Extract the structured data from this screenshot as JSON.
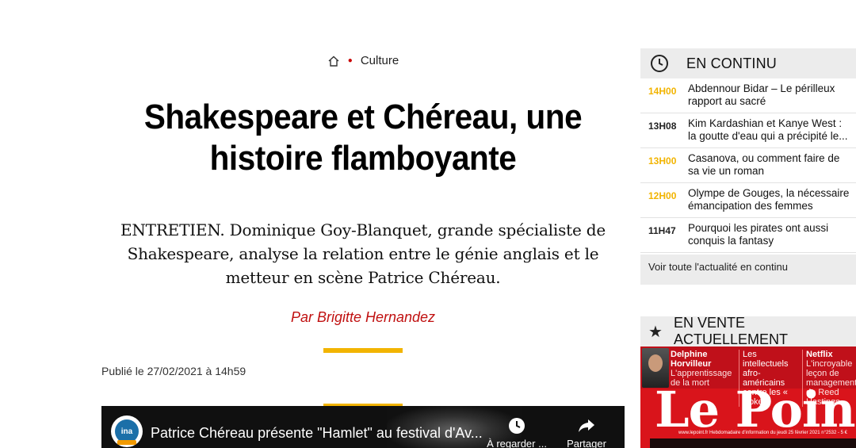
{
  "breadcrumb": {
    "section": "Culture"
  },
  "article": {
    "headline": "Shakespeare et Chéreau, une histoire flamboyante",
    "chapo": "ENTRETIEN. Dominique Goy-Blanquet, grande spécialiste de Shakespeare, analyse la relation entre le génie anglais et le metteur en scène Patrice Chéreau.",
    "author": "Par Brigitte Hernandez",
    "published": "Publié le 27/02/2021 à 14h59"
  },
  "video": {
    "logo_text": "ina",
    "title": "Patrice Chéreau présente \"Hamlet\" au festival d'Av...",
    "later_label": "À regarder ...",
    "share_label": "Partager"
  },
  "continu": {
    "title": "EN CONTINU",
    "items": [
      {
        "time": "14H00",
        "text": "Abdennour Bidar – Le périlleux rapport au sacré",
        "highlight": true
      },
      {
        "time": "13H08",
        "text": "Kim Kardashian et Kanye West : la goutte d'eau qui a précipité le...",
        "highlight": false
      },
      {
        "time": "13H00",
        "text": "Casanova, ou comment faire de sa vie un roman",
        "highlight": true
      },
      {
        "time": "12H00",
        "text": "Olympe de Gouges, la nécessaire émancipation des femmes",
        "highlight": true
      },
      {
        "time": "11H47",
        "text": "Pourquoi les pirates ont aussi conquis la fantasy",
        "highlight": false
      }
    ],
    "footer_link": "Voir toute l'actualité en continu"
  },
  "vente": {
    "title": "EN VENTE ACTUELLEMENT",
    "cover": {
      "teaser1_name": "Delphine Horvilleur",
      "teaser1_sub": "L'apprentissage de la mort",
      "teaser2": "Les intellectuels afro-américains contre les « woke »",
      "teaser3_name": "Netflix",
      "teaser3_sub": "L'incroyable leçon de management de Reed Hastings",
      "logo": "Le Point",
      "meta": "www.lepoint.fr Hebdomadaire d'information du jeudi 25 février 2021 n°2532 - 5 €"
    }
  },
  "colors": {
    "accent": "#f2b400",
    "brand_red": "#d9141b",
    "author_red": "#c01010"
  }
}
